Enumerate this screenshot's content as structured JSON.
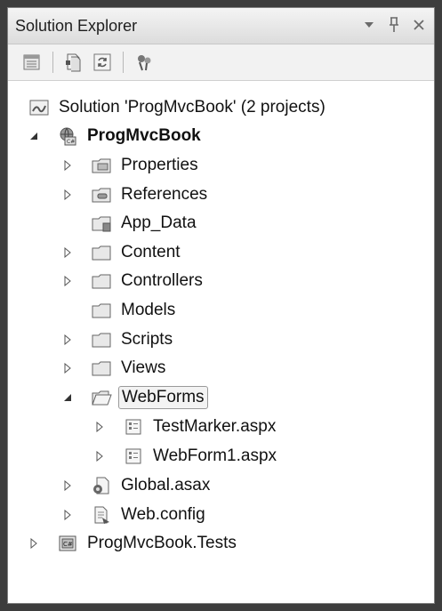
{
  "panel": {
    "title": "Solution Explorer",
    "buttons": [
      "dropdown",
      "pin",
      "close"
    ]
  },
  "toolbar": {
    "tools": [
      "properties-icon",
      "show-all-files-icon",
      "refresh-icon",
      "view-class-diagram-icon"
    ]
  },
  "tree": {
    "solution": "Solution 'ProgMvcBook' (2 projects)",
    "project": "ProgMvcBook",
    "items": {
      "properties": "Properties",
      "references": "References",
      "app_data": "App_Data",
      "content": "Content",
      "controllers": "Controllers",
      "models": "Models",
      "scripts": "Scripts",
      "views": "Views",
      "webforms": "WebForms",
      "testmarker": "TestMarker.aspx",
      "webform1": "WebForm1.aspx",
      "global": "Global.asax",
      "webconfig": "Web.config"
    },
    "tests_project": "ProgMvcBook.Tests",
    "selected": "WebForms"
  }
}
